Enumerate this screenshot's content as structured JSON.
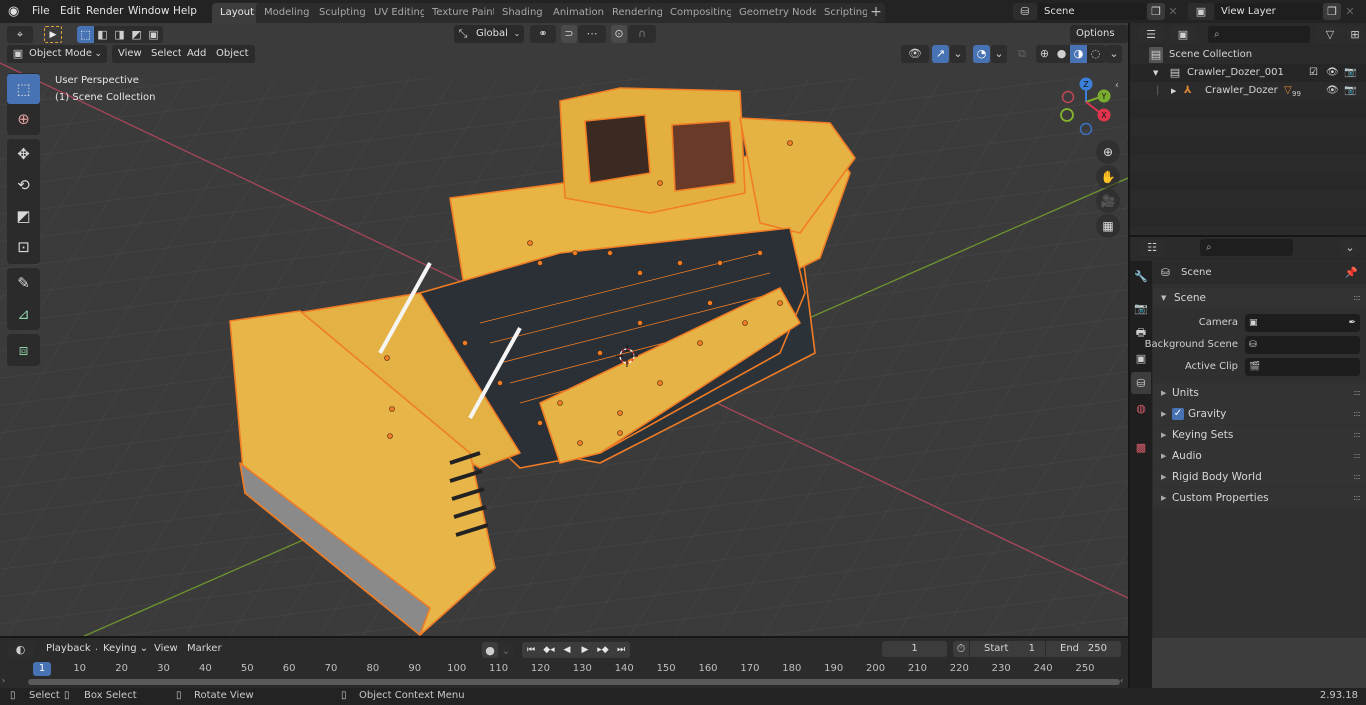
{
  "app": {
    "menus": [
      "File",
      "Edit",
      "Render",
      "Window",
      "Help"
    ],
    "workspace_tabs": [
      "Layout",
      "Modeling",
      "Sculpting",
      "UV Editing",
      "Texture Paint",
      "Shading",
      "Animation",
      "Rendering",
      "Compositing",
      "Geometry Nodes",
      "Scripting"
    ],
    "active_workspace": "Layout",
    "scene_name": "Scene",
    "view_layer_name": "View Layer"
  },
  "viewport": {
    "mode": "Object Mode",
    "header_menus": [
      "View",
      "Select",
      "Add",
      "Object"
    ],
    "transform_orientation": "Global",
    "options_label": "Options",
    "overlay_text": [
      "User Perspective",
      "(1) Scene Collection"
    ],
    "tools": [
      "select-box",
      "cursor",
      "move",
      "rotate",
      "scale",
      "transform",
      "annotate",
      "measure",
      "add-cube"
    ],
    "gizmo_axes": [
      "X",
      "Y",
      "Z"
    ],
    "colors": {
      "background": "#3d3d3d",
      "x_axis": "#a8465a",
      "y_axis": "#6e9530",
      "selection_outline": "#f07d25",
      "model_body": "#e8b545"
    }
  },
  "outliner": {
    "root": "Scene Collection",
    "items": [
      {
        "name": "Crawler_Dozer_001",
        "type": "collection",
        "expanded": true
      },
      {
        "name": "Crawler_Dozer",
        "type": "armature",
        "modifier_count": "99"
      }
    ]
  },
  "properties": {
    "context_title": "Scene",
    "panel_title": "Scene",
    "fields": [
      {
        "label": "Camera",
        "value": ""
      },
      {
        "label": "Background Scene",
        "value": ""
      },
      {
        "label": "Active Clip",
        "value": ""
      }
    ],
    "subpanels": [
      {
        "label": "Units",
        "checkbox": false
      },
      {
        "label": "Gravity",
        "checkbox": true,
        "checked": true
      },
      {
        "label": "Keying Sets",
        "checkbox": false
      },
      {
        "label": "Audio",
        "checkbox": false
      },
      {
        "label": "Rigid Body World",
        "checkbox": false
      },
      {
        "label": "Custom Properties",
        "checkbox": false
      }
    ]
  },
  "timeline": {
    "menus": [
      "Playback",
      "Keying",
      "View",
      "Marker"
    ],
    "current_frame": "1",
    "start_label": "Start",
    "start_frame": "1",
    "end_label": "End",
    "end_frame": "250",
    "ticks": [
      "10",
      "20",
      "30",
      "40",
      "50",
      "60",
      "70",
      "80",
      "90",
      "100",
      "110",
      "120",
      "130",
      "140",
      "150",
      "160",
      "170",
      "180",
      "190",
      "200",
      "210",
      "220",
      "230",
      "240",
      "250"
    ],
    "cursor_label": "1"
  },
  "statusbar": {
    "hints": [
      "Select",
      "Box Select",
      "Rotate View",
      "Object Context Menu"
    ],
    "version": "2.93.18"
  }
}
